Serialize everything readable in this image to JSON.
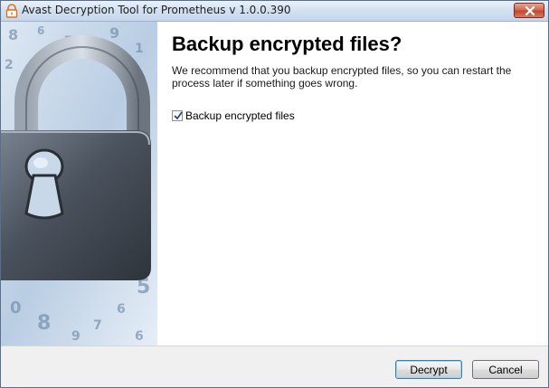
{
  "window": {
    "title": "Avast Decryption Tool for Prometheus v 1.0.0.390",
    "app_icon": "avast-orange-lock-icon",
    "close_icon": "close-icon"
  },
  "banner": {
    "image": "padlock-illustration",
    "digits": [
      "8",
      "6",
      "7",
      "9",
      "1",
      "2",
      "3",
      "4",
      "5",
      "6",
      "0",
      "8",
      "9",
      "7",
      "6",
      "2",
      "3",
      "5",
      "4",
      "1",
      "9"
    ]
  },
  "page": {
    "heading": "Backup encrypted files?",
    "description": "We recommend that you backup encrypted files, so you can restart the process later if something goes wrong.",
    "checkbox": {
      "label": "Backup encrypted files",
      "checked": true
    }
  },
  "footer": {
    "decrypt_label": "Decrypt",
    "cancel_label": "Cancel"
  },
  "colors": {
    "accent": "#3c7fb1",
    "close_red": "#c04a31",
    "title_bg": "#d4e1f2"
  }
}
